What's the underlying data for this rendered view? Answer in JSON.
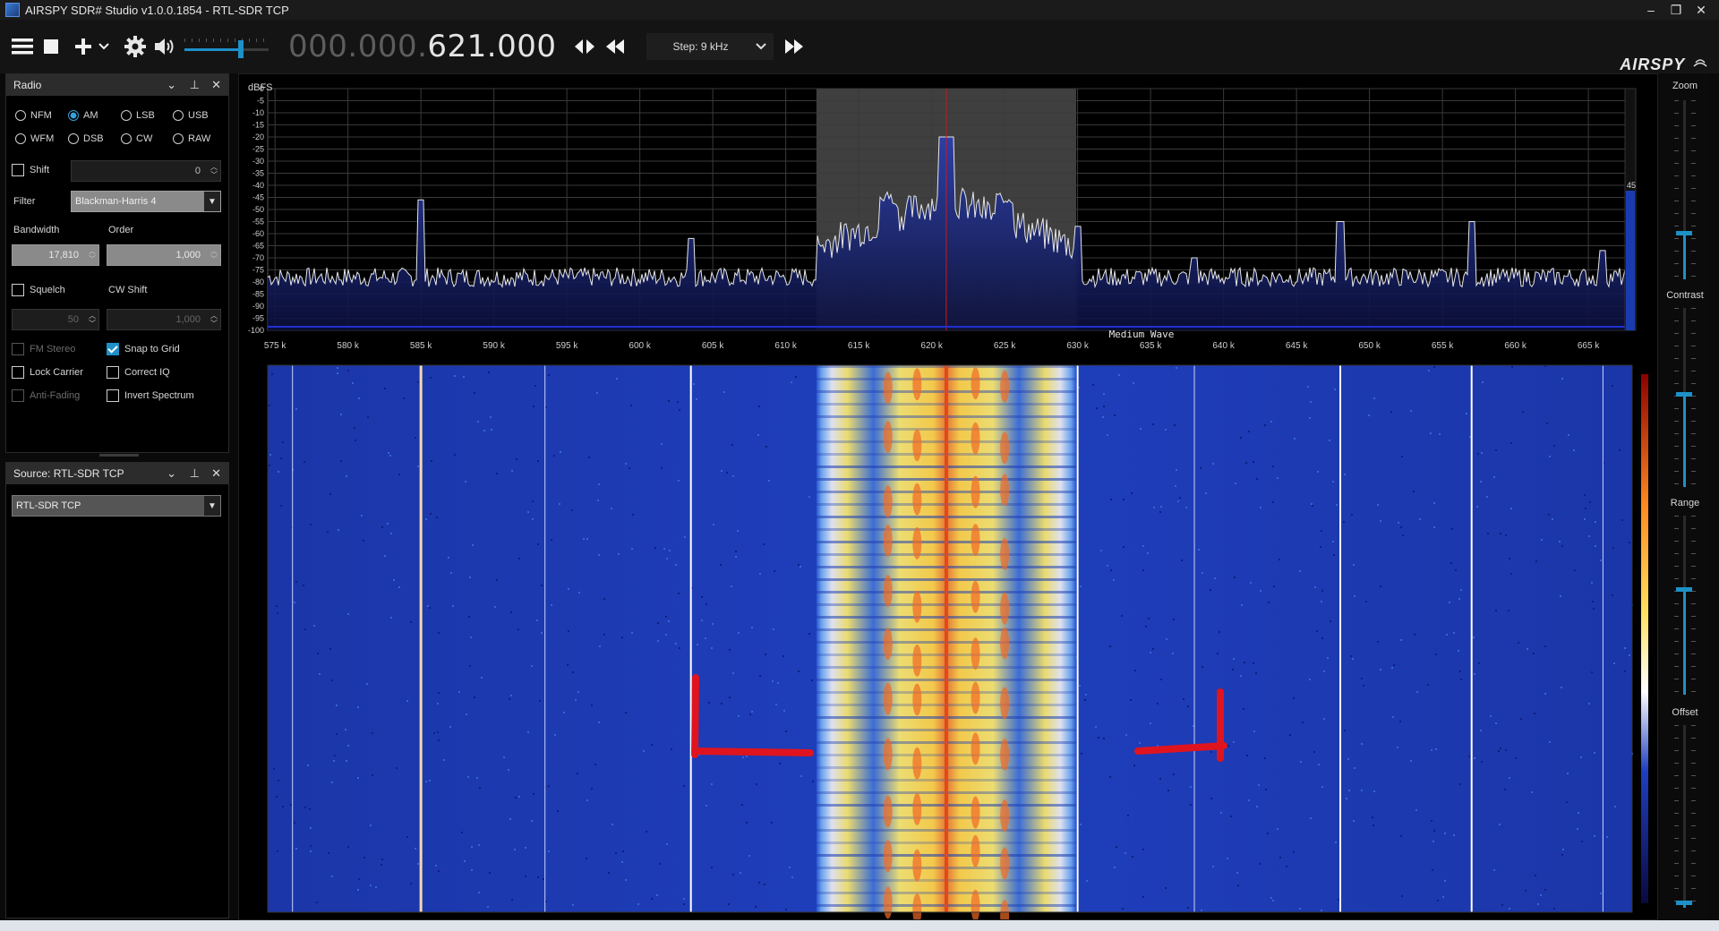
{
  "window": {
    "title": "AIRSPY SDR# Studio v1.0.0.1854 - RTL-SDR TCP",
    "minimize": "–",
    "restore": "❐",
    "close": "✕"
  },
  "toolbar": {
    "menu_icon": "hamburger-icon",
    "frequency_dim": "000.000.",
    "frequency_lit": "621.000",
    "step_label": "Step: 9 kHz",
    "brand": "AIRSPY"
  },
  "radio_panel": {
    "title": "Radio",
    "modes": [
      "NFM",
      "AM",
      "LSB",
      "USB",
      "WFM",
      "DSB",
      "CW",
      "RAW"
    ],
    "selected_mode": "AM",
    "shift_label": "Shift",
    "shift_value": "0",
    "filter_label": "Filter",
    "filter_value": "Blackman-Harris 4",
    "bandwidth_label": "Bandwidth",
    "bandwidth_value": "17,810",
    "order_label": "Order",
    "order_value": "1,000",
    "squelch_label": "Squelch",
    "squelch_value": "50",
    "cwshift_label": "CW Shift",
    "cwshift_value": "1,000",
    "fm_stereo": "FM Stereo",
    "snap_to_grid": "Snap to Grid",
    "lock_carrier": "Lock Carrier",
    "correct_iq": "Correct IQ",
    "anti_fading": "Anti-Fading",
    "invert_spectrum": "Invert Spectrum"
  },
  "source_panel": {
    "title": "Source: RTL-SDR TCP",
    "device": "RTL-SDR TCP"
  },
  "spectrum": {
    "unit_label": "dBFS",
    "db_ticks": [
      "0",
      "-5",
      "-10",
      "-15",
      "-20",
      "-25",
      "-30",
      "-35",
      "-40",
      "-45",
      "-50",
      "-55",
      "-60",
      "-65",
      "-70",
      "-75",
      "-80",
      "-85",
      "-90",
      "-95",
      "-100"
    ],
    "freq_ticks": [
      "575 k",
      "580 k",
      "585 k",
      "590 k",
      "595 k",
      "600 k",
      "605 k",
      "610 k",
      "615 k",
      "620 k",
      "625 k",
      "630 k",
      "635 k",
      "640 k",
      "645 k",
      "650 k",
      "655 k",
      "660 k",
      "665 k"
    ],
    "band_label": "Medium Wave",
    "level_readout": "45",
    "center_khz": 621.0,
    "passband_khz": [
      612.1,
      629.9
    ]
  },
  "side_controls": {
    "zoom": "Zoom",
    "contrast": "Contrast",
    "range": "Range",
    "offset": "Offset"
  },
  "colors": {
    "accent": "#1e90c8",
    "spectrum_fill": "#1a2a8c",
    "waterfall_bg": "#1d3fb3",
    "annotation": "#e0141e"
  }
}
